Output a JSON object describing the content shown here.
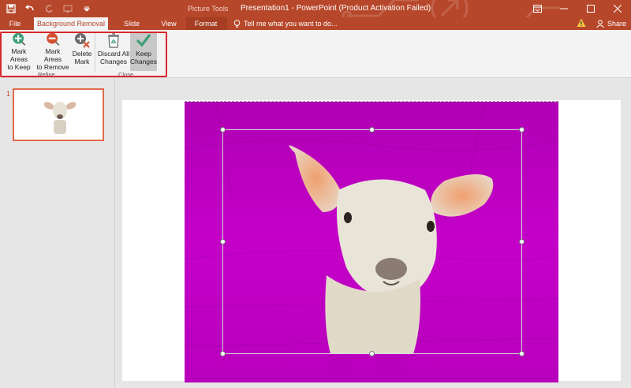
{
  "window": {
    "title": "Presentation1 - PowerPoint (Product Activation Failed)",
    "picture_tools_label": "Picture Tools"
  },
  "tabs": {
    "file": "File",
    "background_removal": "Background Removal",
    "slide_show": "Slide Show",
    "view": "View",
    "format": "Format"
  },
  "tell_me": "Tell me what you want to do...",
  "share": "Share",
  "ribbon": {
    "mark_keep": "Mark Areas\nto Keep",
    "mark_remove": "Mark Areas\nto Remove",
    "delete_mark": "Delete\nMark",
    "discard_all": "Discard All\nChanges",
    "keep_changes": "Keep\nChanges",
    "group_refine": "Refine",
    "group_close": "Close"
  },
  "slides": {
    "current_number": "1"
  },
  "colors": {
    "accent": "#b7472a",
    "removal_overlay": "#c400c8",
    "highlight": "#d9262b"
  },
  "icons": [
    "save-icon",
    "undo-icon",
    "redo-icon",
    "customize-qat-icon",
    "minimize-icon",
    "restore-icon",
    "close-icon",
    "ribbon-display-icon",
    "lightbulb-icon",
    "warning-icon",
    "share-person-icon"
  ]
}
